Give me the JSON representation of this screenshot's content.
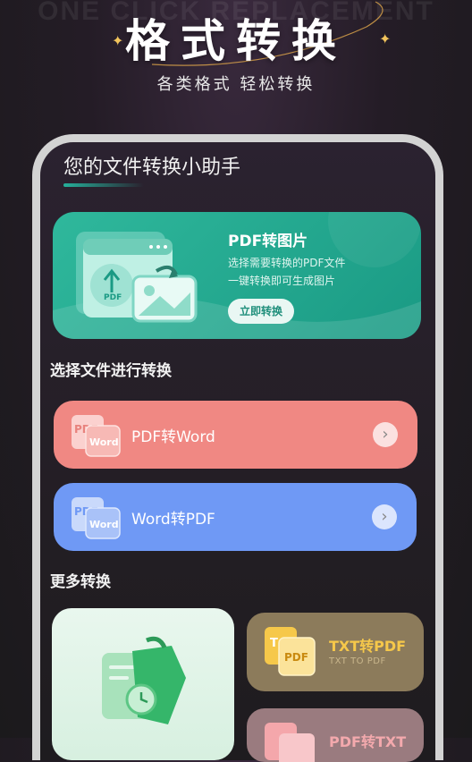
{
  "header": {
    "bg_text": "ONE CLICK REPLACEMENT",
    "title": "格式转换",
    "subtitle": "各类格式  轻松转换"
  },
  "phone": {
    "title": "您的文件转换小助手",
    "banner": {
      "title": "PDF转图片",
      "desc_line1": "选择需要转换的PDF文件",
      "desc_line2": "一键转换即可生成图片",
      "button_label": "立即转换",
      "illus_label": "PDF"
    },
    "select_section": {
      "label": "选择文件进行转换",
      "cards": [
        {
          "label": "PDF转Word",
          "icon_back": "PDF",
          "icon_front": "Word",
          "color": "#f08883"
        },
        {
          "label": "Word转PDF",
          "icon_back": "PDF",
          "icon_front": "Word",
          "color": "#6f99f5"
        }
      ]
    },
    "more_section": {
      "label": "更多转换",
      "cards": [
        {
          "title": "TXT转PDF",
          "subtitle": "TXT TO PDF",
          "icon_back": "T",
          "icon_front": "PDF",
          "color": "#8c7b5b"
        },
        {
          "title": "PDF转TXT",
          "color": "#9a7b7f"
        }
      ]
    }
  },
  "colors": {
    "accent_green": "#1a9a84",
    "pink": "#f08883",
    "blue": "#6f99f5",
    "gold": "#f6c84a"
  }
}
